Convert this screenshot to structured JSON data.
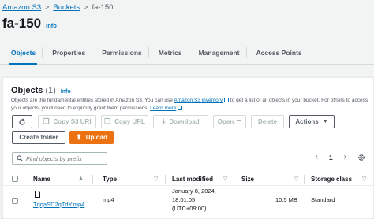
{
  "breadcrumb": {
    "items": [
      "Amazon S3",
      "Buckets"
    ],
    "current": "fa-150",
    "separator": ">"
  },
  "page": {
    "title": "fa-150",
    "info": "Info"
  },
  "tabs": [
    "Objects",
    "Properties",
    "Permissions",
    "Metrics",
    "Management",
    "Access Points"
  ],
  "active_tab": "Objects",
  "objects": {
    "title": "Objects",
    "count": "(1)",
    "info": "Info",
    "desc_part1": "Objects are the fundamental entities stored in Amazon S3. You can use ",
    "desc_link1": "Amazon S3 inventory",
    "desc_part2": " to get a list of all objects in your bucket. For others to access your objects, you'll need to explicitly grant them permissions. ",
    "desc_link2": "Learn more"
  },
  "toolbar": {
    "copy_s3_uri": "Copy S3 URI",
    "copy_url": "Copy URL",
    "download": "Download",
    "open": "Open",
    "delete": "Delete",
    "actions": "Actions",
    "create_folder": "Create folder",
    "upload": "Upload"
  },
  "search": {
    "placeholder": "Find objects by prefix"
  },
  "pagination": {
    "page": "1"
  },
  "table": {
    "columns": [
      "Name",
      "Type",
      "Last modified",
      "Size",
      "Storage class"
    ],
    "rows": [
      {
        "name": "TqqaSD2qTdY.mp4",
        "type": "mp4",
        "modified_line1": "January 8, 2024,",
        "modified_line2": "18:01:05",
        "modified_line3": "(UTC+09:00)",
        "size": "10.5 MB",
        "storage_class": "Standard"
      }
    ]
  },
  "colors": {
    "accent": "#0073bb",
    "primary_button": "#ec7211",
    "text": "#16191f"
  }
}
